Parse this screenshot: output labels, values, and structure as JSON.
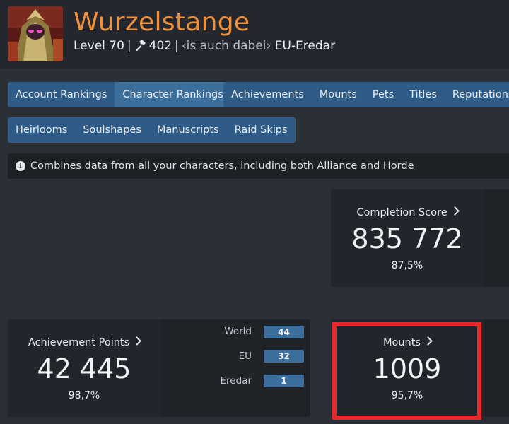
{
  "character": {
    "name": "Wurzelstange",
    "level": "Level 70",
    "item_level": "402",
    "guild": "‹is auch dabei›",
    "realm": "EU-Eredar"
  },
  "tabs_row1_group1": [
    "Account Rankings",
    "Character Rankings"
  ],
  "tabs_row1_group2": [
    "Achievements",
    "Mounts",
    "Pets",
    "Titles",
    "Reputations"
  ],
  "tabs_row2": [
    "Heirlooms",
    "Soulshapes",
    "Manuscripts",
    "Raid Skips"
  ],
  "active_tab": "Character Rankings",
  "info": {
    "text": "Combines data from all your characters, including both Alliance and Horde"
  },
  "completion": {
    "title": "Completion Score",
    "value": "835 772",
    "percent": "87,5%"
  },
  "achievement": {
    "title": "Achievement Points",
    "value": "42 445",
    "percent": "98,7%",
    "ranks": [
      {
        "label": "World",
        "value": "44"
      },
      {
        "label": "EU",
        "value": "32"
      },
      {
        "label": "Eredar",
        "value": "1"
      }
    ]
  },
  "mounts": {
    "title": "Mounts",
    "value": "1009",
    "percent": "95,7%"
  },
  "colors": {
    "name_orange": "#f0913b",
    "button_blue": "#2f5c86",
    "highlight_red": "#e8282b"
  }
}
